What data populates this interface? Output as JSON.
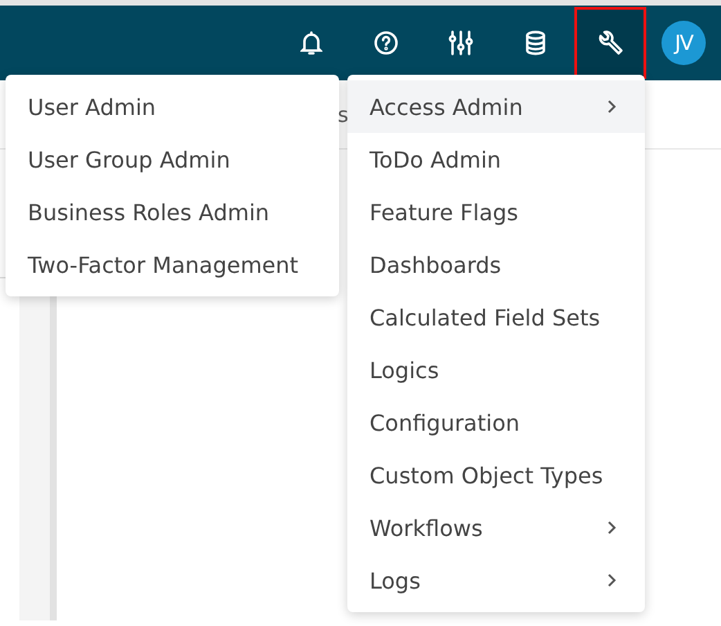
{
  "navbar": {
    "icons": [
      {
        "kind": "bell",
        "selected": false
      },
      {
        "kind": "help",
        "selected": false
      },
      {
        "kind": "sliders",
        "selected": false
      },
      {
        "kind": "database",
        "selected": false
      },
      {
        "kind": "wrench",
        "selected": true
      }
    ],
    "avatar": {
      "initials": "JV"
    }
  },
  "page": {
    "header_fragment": "s"
  },
  "admin_menu": {
    "items": [
      {
        "label": "Access Admin",
        "submenu": true,
        "selected": true
      },
      {
        "label": "ToDo Admin",
        "submenu": false,
        "selected": false
      },
      {
        "label": "Feature Flags",
        "submenu": false,
        "selected": false
      },
      {
        "label": "Dashboards",
        "submenu": false,
        "selected": false
      },
      {
        "label": "Calculated Field Sets",
        "submenu": false,
        "selected": false
      },
      {
        "label": "Logics",
        "submenu": false,
        "selected": false
      },
      {
        "label": "Configuration",
        "submenu": false,
        "selected": false
      },
      {
        "label": "Custom Object Types",
        "submenu": false,
        "selected": false
      },
      {
        "label": "Workflows",
        "submenu": true,
        "selected": false
      },
      {
        "label": "Logs",
        "submenu": true,
        "selected": false
      }
    ]
  },
  "access_submenu": {
    "items": [
      {
        "label": "User Admin",
        "selected": false
      },
      {
        "label": "User Group Admin",
        "selected": false
      },
      {
        "label": "Business Roles Admin",
        "selected": false
      },
      {
        "label": "Two-Factor Management",
        "selected": false
      }
    ]
  }
}
